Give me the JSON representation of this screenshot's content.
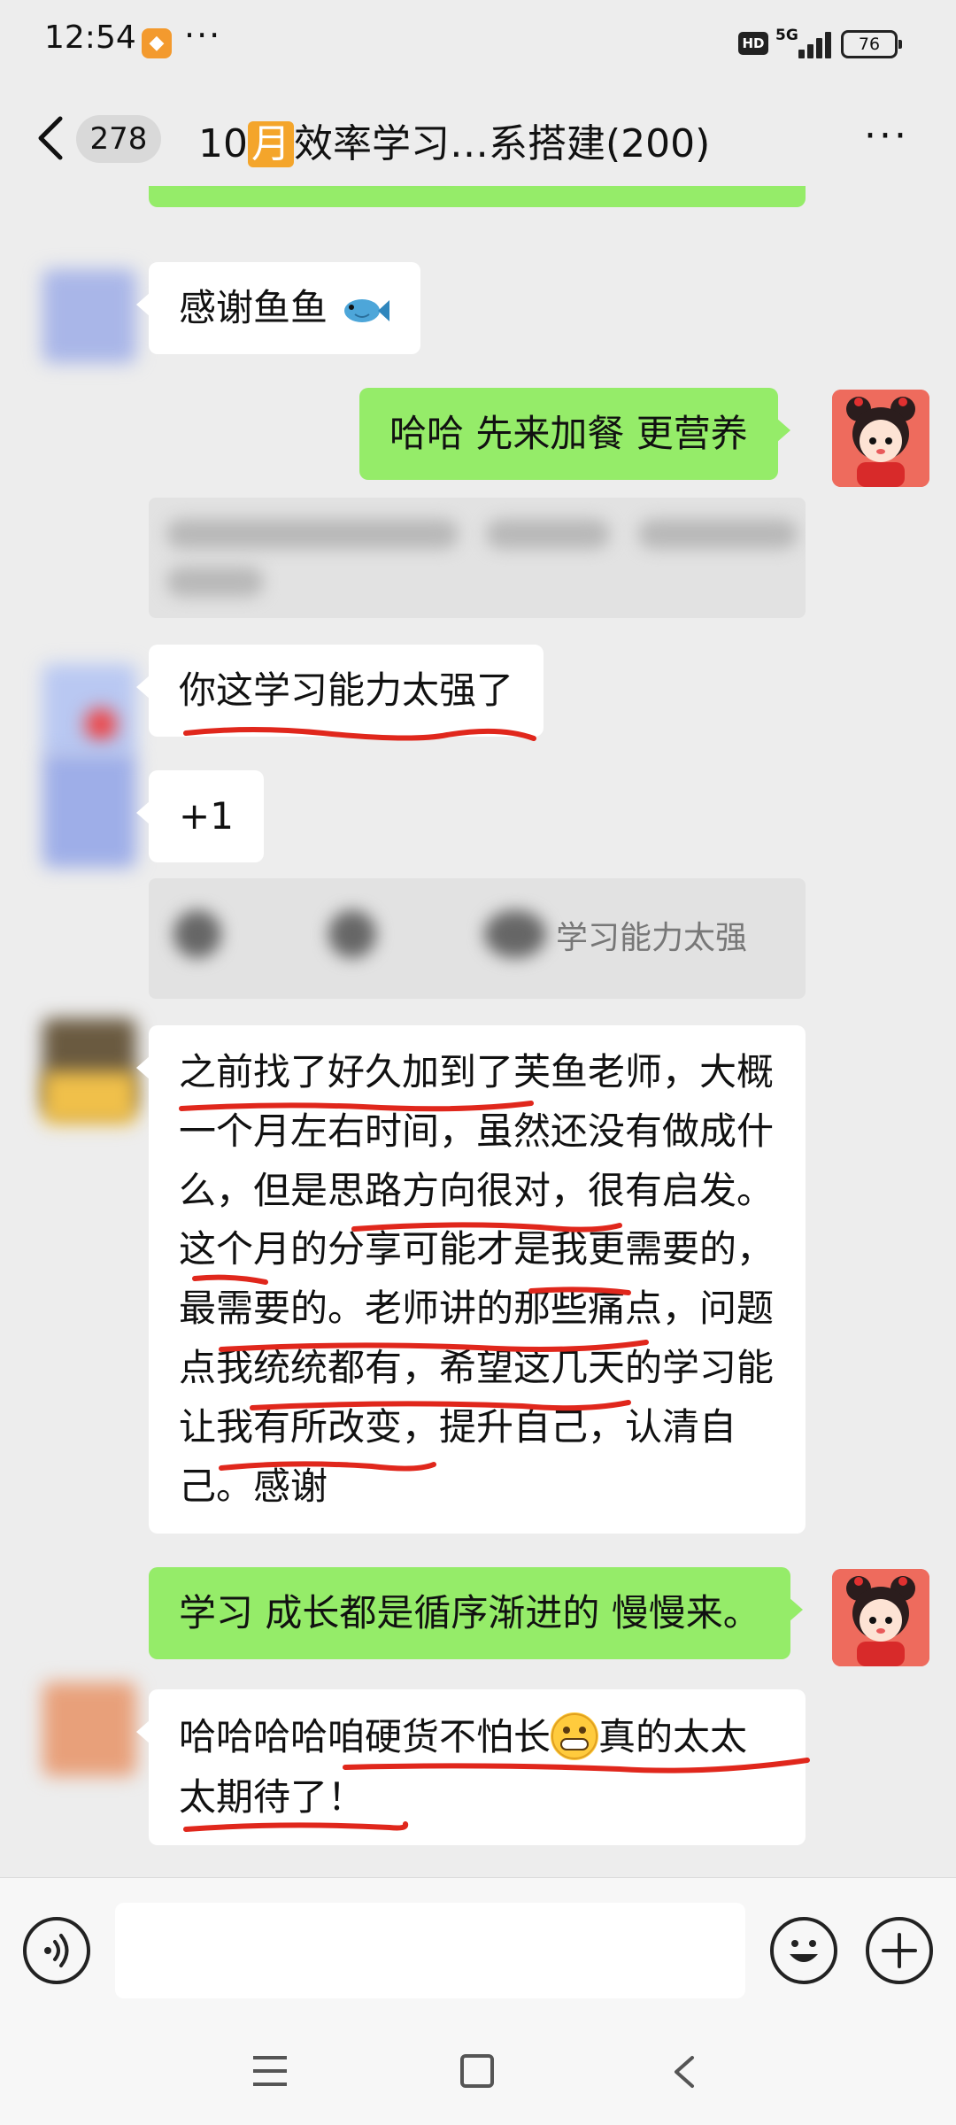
{
  "status_bar": {
    "time": "12:54",
    "more": "···",
    "hd": "HD",
    "network": "5G",
    "battery": "76"
  },
  "header": {
    "unread_count": "278",
    "title_prefix": "10",
    "title_month": "月",
    "title_rest": "效率学习…系搭建(200)",
    "more": "···"
  },
  "messages": {
    "m1": "感谢鱼鱼",
    "m2": "哈哈 先来加餐 更营养",
    "m3": "你这学习能力太强了",
    "m4": "+1",
    "m4_quote": "学习能力太强",
    "m5": "之前找了好久加到了芙鱼老师，大概一个月左右时间，虽然还没有做成什么，但是思路方向很对，很有启发。这个月的分享可能才是我更需要的，最需要的。老师讲的那些痛点，问题点我统统都有，希望这几天的学习能让我有所改变，提升自己，认清自己。感谢",
    "m6": "学习 成长都是循序渐进的 慢慢来。",
    "m7_a": "哈哈哈哈咱硬货不怕长",
    "m7_b": "真的太太太期待了！"
  },
  "icons": {
    "fish": "fish-emoji-icon",
    "grin": "grinning-emoji-icon",
    "voice": "voice-icon",
    "emoji": "emoji-icon",
    "plus": "plus-icon"
  },
  "colors": {
    "green_bubble": "#95ec69",
    "white_bubble": "#ffffff",
    "background": "#ededed",
    "underline_red": "#e0271c"
  }
}
